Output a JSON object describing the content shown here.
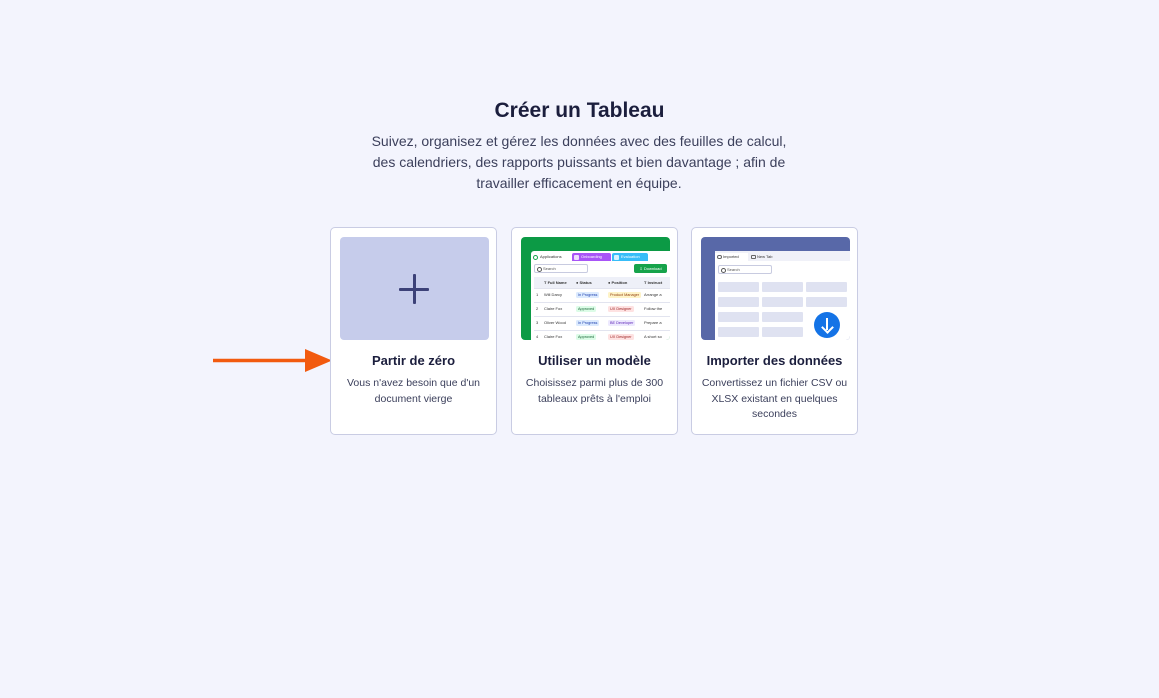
{
  "header": {
    "title": "Créer un Tableau",
    "subtitle": "Suivez, organisez et gérez les données avec des feuilles de calcul, des calendriers, des rapports puissants et bien davantage ; afin de travailler efficacement en équipe."
  },
  "cards": [
    {
      "title": "Partir de zéro",
      "description": "Vous n'avez besoin que d'un document vierge",
      "icon": "plus-icon"
    },
    {
      "title": "Utiliser un modèle",
      "description": "Choisissez parmi plus de 300 tableaux prêts à l'emploi",
      "preview": {
        "tabs": [
          "Applications",
          "Onboarding",
          "Evaluation"
        ],
        "search": "Search",
        "download": "Download",
        "columns": [
          "Full Name",
          "Status",
          "Position",
          "Instruct"
        ],
        "rows": [
          [
            "Will Darcy",
            "In Progress",
            "Product Manager",
            "Arrange a"
          ],
          [
            "Claire Fox",
            "Approved",
            "UX Designer",
            "Follow the"
          ],
          [
            "Oliver Wood",
            "In Progress",
            "BE Developer",
            "Prepare a"
          ],
          [
            "Claire Fox",
            "Approved",
            "UX Designer",
            "A short so"
          ]
        ],
        "row_numbers": [
          "1",
          "2",
          "3",
          "4"
        ]
      }
    },
    {
      "title": "Importer des données",
      "description": "Convertissez un fichier CSV ou XLSX existant en quelques secondes",
      "preview": {
        "tabs": [
          "Imported",
          "New Tab"
        ],
        "search": "Search"
      }
    }
  ],
  "colors": {
    "background": "#f3f4fd",
    "scratch_thumb": "#c6cceb",
    "template_thumb": "#0c9a45",
    "import_thumb": "#5868a8",
    "annotation_arrow": "#f25a0f"
  }
}
